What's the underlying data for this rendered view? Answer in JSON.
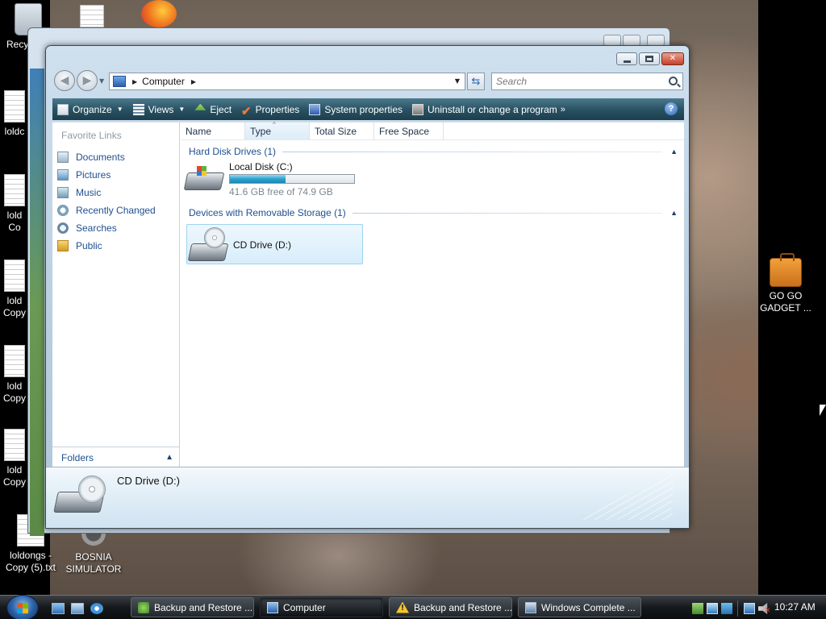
{
  "desktop": {
    "icons": [
      {
        "label": "Recy",
        "icon": "recycle-bin-icon"
      },
      {
        "label": "loldc",
        "icon": "text-file-icon"
      },
      {
        "label": "lold\nCo",
        "icon": "text-file-icon"
      },
      {
        "label": "lold\nCopy",
        "icon": "text-file-icon"
      },
      {
        "label": "lold\nCopy",
        "icon": "text-file-icon"
      },
      {
        "label": "lold\nCopy",
        "icon": "text-file-icon"
      },
      {
        "label": "loldongs -\nCopy (5).txt",
        "icon": "text-file-icon"
      },
      {
        "label": "BOSNIA\nSIMULATOR",
        "icon": "gear-shortcut-icon"
      },
      {
        "label": "GO GO\nGADGET ...",
        "icon": "briefcase-icon"
      }
    ]
  },
  "window": {
    "controls": {
      "minimize": "minimize",
      "maximize": "maximize",
      "close": "close"
    },
    "address": {
      "location": "Computer"
    },
    "search": {
      "placeholder": "Search"
    },
    "toolbar": {
      "organize": "Organize",
      "views": "Views",
      "eject": "Eject",
      "properties": "Properties",
      "system_properties": "System properties",
      "uninstall": "Uninstall or change a program",
      "more": "»",
      "help": "?"
    },
    "nav": {
      "heading": "Favorite Links",
      "items": [
        {
          "label": "Documents",
          "icon": "documents-icon"
        },
        {
          "label": "Pictures",
          "icon": "pictures-icon"
        },
        {
          "label": "Music",
          "icon": "music-icon"
        },
        {
          "label": "Recently Changed",
          "icon": "recently-changed-icon"
        },
        {
          "label": "Searches",
          "icon": "searches-icon"
        },
        {
          "label": "Public",
          "icon": "public-folder-icon"
        }
      ],
      "folders": "Folders"
    },
    "columns": [
      "Name",
      "Type",
      "Total Size",
      "Free Space"
    ],
    "sorted_column": "Type",
    "groups": {
      "hard_disk": {
        "title": "Hard Disk Drives (1)",
        "drive": {
          "name": "Local Disk (C:)",
          "free_text": "41.6 GB free of 74.9 GB",
          "used_fraction": 0.445,
          "icon": "hard-disk-icon"
        }
      },
      "removable": {
        "title": "Devices with Removable Storage (1)",
        "drive": {
          "name": "CD Drive (D:)",
          "icon": "cd-drive-icon",
          "selected": true
        }
      }
    },
    "details": {
      "name": "CD Drive (D:)",
      "icon": "cd-drive-icon"
    }
  },
  "taskbar": {
    "quick_launch": [
      "show-desktop-icon",
      "switch-windows-icon",
      "internet-explorer-icon"
    ],
    "buttons": [
      {
        "label": "Backup and Restore ...",
        "icon": "backup-restore-icon",
        "active": false
      },
      {
        "label": "Computer",
        "icon": "computer-icon",
        "active": true
      },
      {
        "label": "Backup and Restore ...",
        "icon": "warning-icon",
        "active": false
      },
      {
        "label": "Windows Complete ...",
        "icon": "windows-complete-icon",
        "active": false
      }
    ],
    "clock": "10:27 AM"
  },
  "colors": {
    "toolbar": "#2a5364",
    "link": "#1f4f8f",
    "usage_fill": "#2ba3cf",
    "selection": "#d7eefb"
  }
}
